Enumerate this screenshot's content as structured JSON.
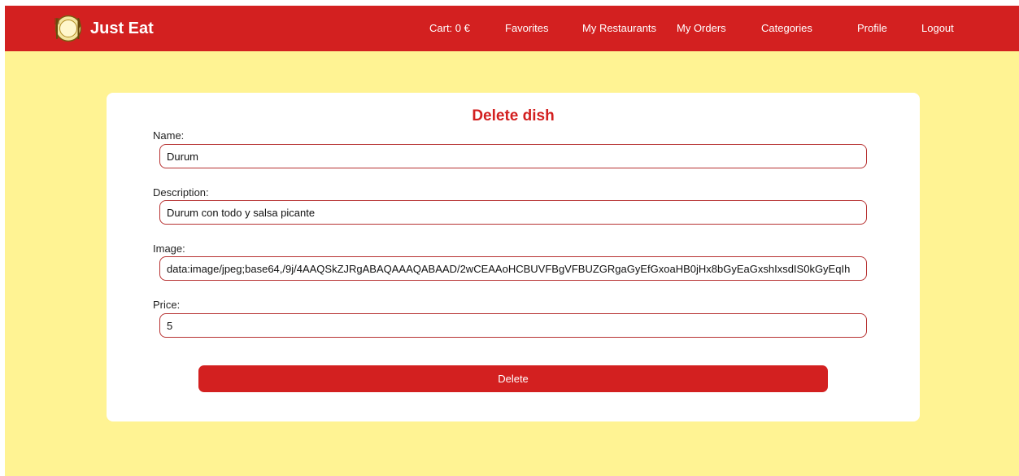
{
  "brand": {
    "name": "Just Eat",
    "logo_icon": "plate-fork-knife-icon"
  },
  "nav": {
    "cart": "Cart: 0 €",
    "favorites": "Favorites",
    "my_restaurants": "My Restaurants",
    "my_orders": "My Orders",
    "categories": "Categories",
    "profile": "Profile",
    "logout": "Logout"
  },
  "form": {
    "title": "Delete dish",
    "fields": {
      "name": {
        "label": "Name:",
        "value": "Durum"
      },
      "description": {
        "label": "Description:",
        "value": "Durum con todo y salsa picante"
      },
      "image": {
        "label": "Image:",
        "value": "data:image/jpeg;base64,/9j/4AAQSkZJRgABAQAAAQABAAD/2wCEAAoHCBUVFBgVFBUZGRgaGyEfGxoaHB0jHx8bGyEaGxshIxsdIS0kGyEqIh"
      },
      "price": {
        "label": "Price:",
        "value": "5"
      }
    },
    "submit_label": "Delete"
  },
  "colors": {
    "primary": "#d32020",
    "background": "#fff393",
    "card": "#ffffff",
    "input_border": "#b73232"
  }
}
